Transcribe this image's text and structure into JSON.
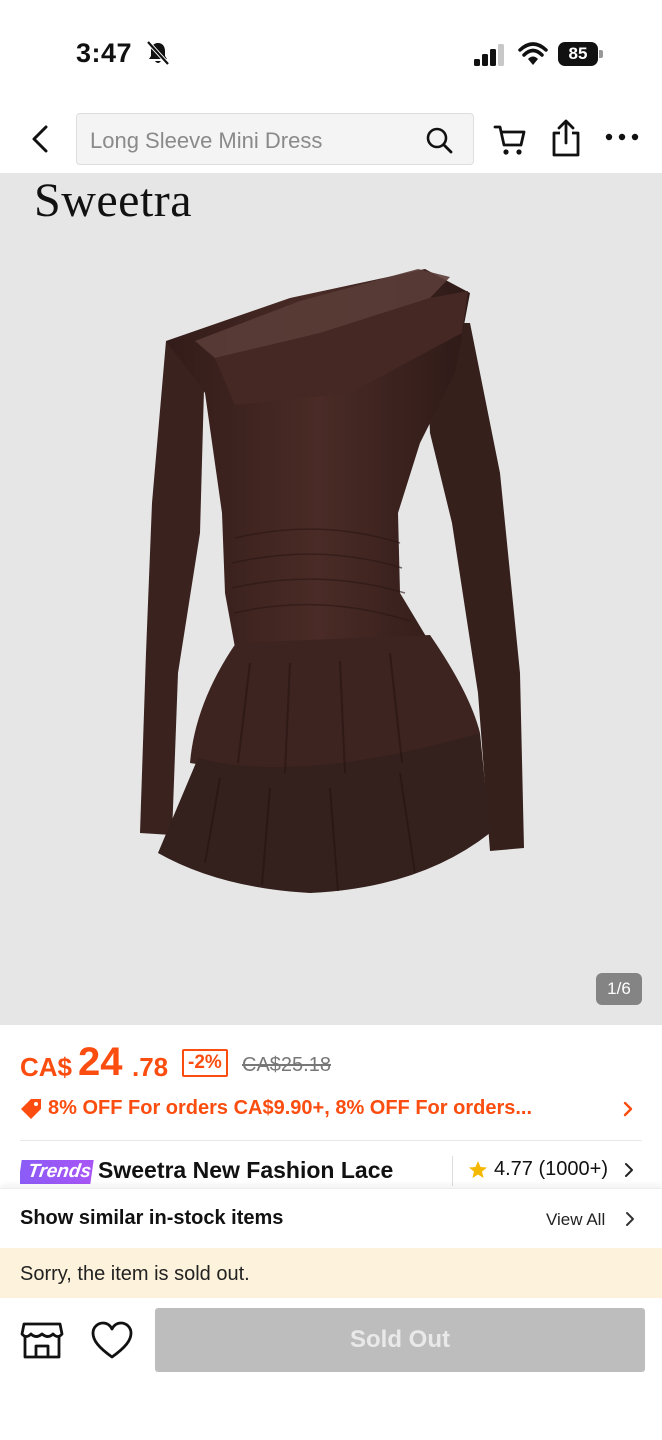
{
  "status_bar": {
    "time": "3:47",
    "battery": "85"
  },
  "nav": {
    "search_placeholder": "Long Sleeve Mini Dress"
  },
  "hero": {
    "brand_logo": "Sweetra",
    "pager": "1/6"
  },
  "price": {
    "currency": "CA$",
    "main": "24",
    "decimal": ".78",
    "discount": "-2%",
    "original": "CA$25.18"
  },
  "promo": {
    "text": "8% OFF For orders CA$9.90+,  8% OFF For orders..."
  },
  "product": {
    "badge": "Trends",
    "title": "Sweetra New Fashion Lace",
    "rating": "4.77 (1000+)"
  },
  "similar": {
    "label": "Show similar in-stock items",
    "view_all": "View All"
  },
  "notice": {
    "sold_out_message": "Sorry, the item is sold out."
  },
  "bottom_bar": {
    "button_label": "Sold Out"
  },
  "colors": {
    "accent": "#fa4d0f",
    "banner": "#fdf3dc",
    "dress": "#3f2420",
    "disabled": "#bdbdbd"
  }
}
